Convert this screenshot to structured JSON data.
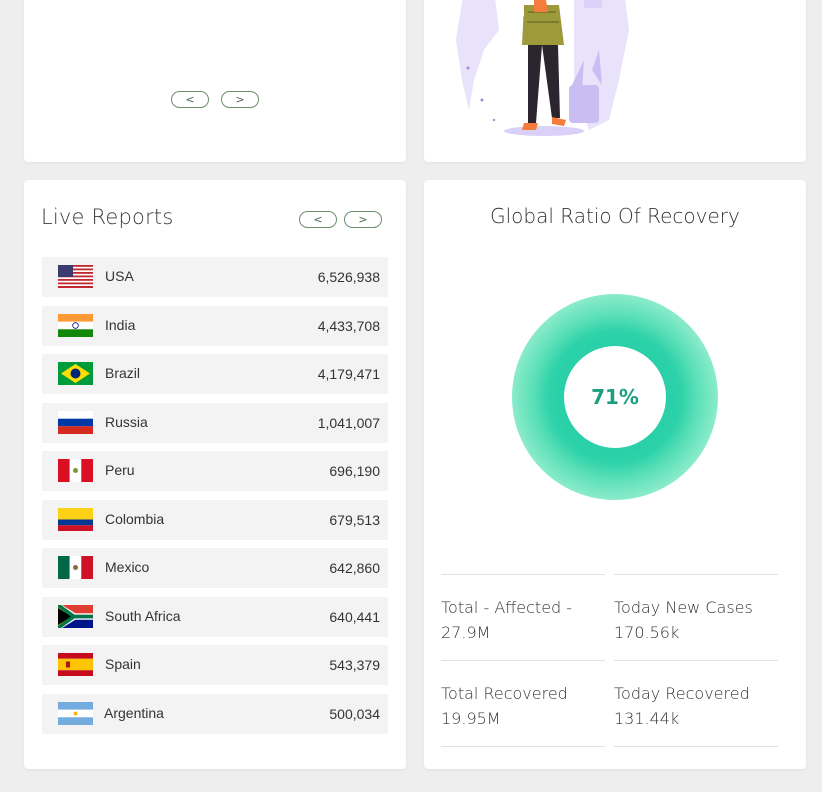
{
  "carousel_top": {
    "prev_label": "<",
    "next_label": ">"
  },
  "live_reports": {
    "title": "Live Reports",
    "prev_label": "<",
    "next_label": ">",
    "rows": [
      {
        "country": "USA",
        "count": "6,526,938",
        "flag": "us-flag"
      },
      {
        "country": "India",
        "count": "4,433,708",
        "flag": "india-flag"
      },
      {
        "country": "Brazil",
        "count": "4,179,471",
        "flag": "brazil-flag"
      },
      {
        "country": "Russia",
        "count": "1,041,007",
        "flag": "russia-flag"
      },
      {
        "country": "Peru",
        "count": "696,190",
        "flag": "peru-flag"
      },
      {
        "country": "Colombia",
        "count": "679,513",
        "flag": "colombia-flag"
      },
      {
        "country": "Mexico",
        "count": "642,860",
        "flag": "mexico-flag"
      },
      {
        "country": "South Africa",
        "count": "640,441",
        "flag": "south-africa-flag"
      },
      {
        "country": "Spain",
        "count": "543,379",
        "flag": "spain-flag"
      },
      {
        "country": "Argentina",
        "count": "500,034",
        "flag": "argentina-flag"
      }
    ]
  },
  "recovery": {
    "title": "Global Ratio Of Recovery",
    "percent_label": "71%",
    "ratio": 0.71,
    "colors": {
      "ring": "#2dd2a9",
      "label": "#1a9f80"
    },
    "stats": [
      {
        "label": "Total - Affected -",
        "value": "27.9M"
      },
      {
        "label": "Today New Cases",
        "value": "170.56k"
      },
      {
        "label": "Total Recovered",
        "value": "19.95M"
      },
      {
        "label": "Today Recovered",
        "value": "131.44k"
      }
    ]
  }
}
